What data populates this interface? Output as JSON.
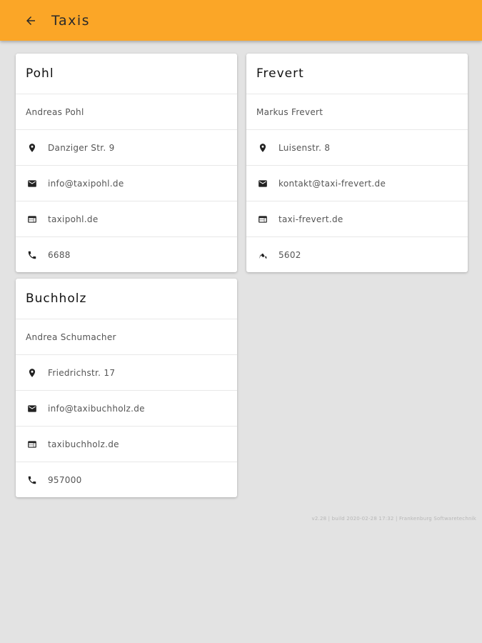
{
  "appbar": {
    "title": "Taxis"
  },
  "cards": [
    {
      "title": "Pohl",
      "contact": "Andreas Pohl",
      "address": "Danziger Str. 9",
      "email": "info@taxipohl.de",
      "web": "taxipohl.de",
      "phone": "6688"
    },
    {
      "title": "Frevert",
      "contact": "Markus Frevert",
      "address": "Luisenstr. 8",
      "email": "kontakt@taxi-frevert.de",
      "web": "taxi-frevert.de",
      "phone": "5602"
    },
    {
      "title": "Buchholz",
      "contact": "Andrea Schumacher",
      "address": "Friedrichstr. 17",
      "email": "info@taxibuchholz.de",
      "web": "taxibuchholz.de",
      "phone": "957000"
    }
  ],
  "footer": {
    "text": "v2.28 | build 2020-02-28 17:32 | Frankenburg Softwaretechnik"
  },
  "colors": {
    "appbar": "#fba627",
    "background": "#e3e3e3"
  },
  "icons": [
    "back-arrow-icon",
    "location-pin-icon",
    "mail-icon",
    "web-icon",
    "phone-icon"
  ]
}
